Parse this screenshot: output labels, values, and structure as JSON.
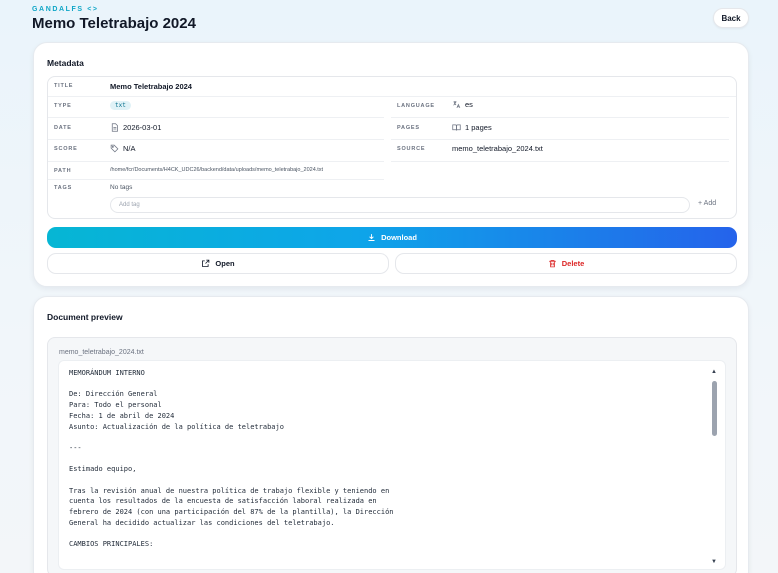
{
  "header": {
    "brand": "GANDALFS <>",
    "title": "Memo Teletrabajo 2024",
    "back_label": "Back"
  },
  "metadata": {
    "section_title": "Metadata",
    "title_label": "TITLE",
    "title_value": "Memo Teletrabajo 2024",
    "type_label": "TYPE",
    "type_value": "txt",
    "language_label": "LANGUAGE",
    "language_value": "es",
    "date_label": "DATE",
    "date_value": "2026-03-01",
    "pages_label": "PAGES",
    "pages_value": "1 pages",
    "score_label": "SCORE",
    "score_value": "N/A",
    "source_label": "SOURCE",
    "source_value": "memo_teletrabajo_2024.txt",
    "path_label": "PATH",
    "path_value": "/home/fcr/Documents/H4CK_UDC26/backend/data/uploads/memo_teletrabajo_2024.txt",
    "tags_label": "TAGS",
    "tags_value": "No tags",
    "tag_placeholder": "Add tag",
    "add_label": "+ Add"
  },
  "actions": {
    "download": "Download",
    "open": "Open",
    "delete": "Delete"
  },
  "preview": {
    "section_title": "Document preview",
    "file_name": "memo_teletrabajo_2024.txt",
    "content": "MEMORÁNDUM INTERNO\n\nDe: Dirección General\nPara: Todo el personal\nFecha: 1 de abril de 2024\nAsunto: Actualización de la política de teletrabajo\n\n---\n\nEstimado equipo,\n\nTras la revisión anual de nuestra política de trabajo flexible y teniendo en\ncuenta los resultados de la encuesta de satisfacción laboral realizada en\nfebrero de 2024 (con una participación del 87% de la plantilla), la Dirección\nGeneral ha decidido actualizar las condiciones del teletrabajo.\n\nCAMBIOS PRINCIPALES:"
  },
  "colors": {
    "accent_start": "#06b6d4",
    "accent_end": "#2563eb",
    "danger": "#dc2626",
    "brand": "#0ea5c6"
  }
}
